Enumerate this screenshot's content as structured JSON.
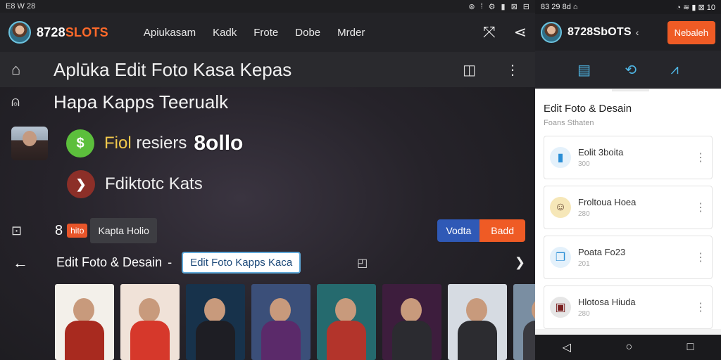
{
  "left_status": {
    "time": "E8 W 28",
    "icons": [
      "⊛",
      "⁞",
      "⚙",
      "▮",
      "⊠",
      "⊟"
    ]
  },
  "header": {
    "brand_prefix": "8728",
    "brand_highlight": "SLOTS",
    "nav": [
      "Apiukasam",
      "Kadk",
      "Frote",
      "Dobe",
      "Mrder"
    ]
  },
  "toolbar": {
    "title": "Aplūka Edit Foto Kasa Kepas"
  },
  "rows": {
    "r1_text": "Hapa Kapps Teerualk",
    "r2_text_a": "Fiol",
    "r2_text_b": " resiers ",
    "r2_big": "8ollo",
    "r3_text": "Fdiktotc Kats",
    "r4_num": "8",
    "r4_pill": "hito",
    "r4_chip": "Kapta Holio",
    "btn_blue": "Vodta",
    "btn_orange": "Badd"
  },
  "section": {
    "title": "Edit Foto & Desain",
    "dash": "-",
    "input_value": "Edit Foto Kapps Kaca"
  },
  "posters": [
    {
      "label": "",
      "bg": "#f3f0ea",
      "body": "#a82a1f"
    },
    {
      "label": "",
      "bg": "#f0e2d8",
      "body": "#d6382b"
    },
    {
      "label": "",
      "bg": "#17324b",
      "body": "#1e1e24"
    },
    {
      "label": "",
      "bg": "#3b4f79",
      "body": "#5b2a6a"
    },
    {
      "label": "",
      "bg": "#256a6e",
      "body": "#b3342b"
    },
    {
      "label": "",
      "bg": "#3d1d3d",
      "body": "#2b2b30"
    },
    {
      "label": "",
      "bg": "#d6dbe2",
      "body": "#2c2c30"
    },
    {
      "label": "",
      "bg": "#7a8ea2",
      "body": "#3a3a40"
    }
  ],
  "mobile": {
    "status_left": "83 29 8d ⌂",
    "status_right": "◔ ≋ ▮ ⊠ 10",
    "brand": "8728SbOTS",
    "back": "‹",
    "cta": "Nebaleh",
    "section_title": "Edit Foto & Desain",
    "section_sub": "Foans Sthaten",
    "cards": [
      {
        "title": "Eolit 3boita",
        "sub": "300",
        "icon_color": "#e4f1fb",
        "icon_fg": "#2a8ed6"
      },
      {
        "title": "Froltoua Hoea",
        "sub": "280",
        "icon_color": "#f6e7b8",
        "icon_fg": "#5a3a2a"
      },
      {
        "title": "Poata Fo23",
        "sub": "201",
        "icon_color": "#e4f1fb",
        "icon_fg": "#2a8ed6"
      },
      {
        "title": "Hlotosa Hiuda",
        "sub": "280",
        "icon_color": "#e6e6e6",
        "icon_fg": "#7a2020"
      }
    ]
  }
}
